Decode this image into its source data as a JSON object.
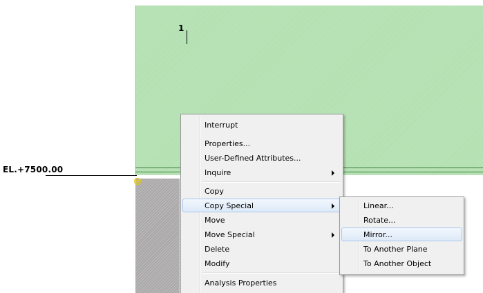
{
  "canvas": {
    "grid_label": "1",
    "elevation_label": "EL.+7500.00",
    "colors": {
      "slab_fill": "#b2e0b0",
      "column_fill": "#a9a7a7",
      "snap_marker": "#e3c820",
      "menu_background": "#f0f0f0",
      "highlight_border": "#a8c6ee"
    }
  },
  "context_menu": {
    "items": [
      {
        "label": "Interrupt"
      },
      {
        "label": "Properties..."
      },
      {
        "label": "User-Defined Attributes..."
      },
      {
        "label": "Inquire"
      },
      {
        "label": "Copy"
      },
      {
        "label": "Copy Special"
      },
      {
        "label": "Move"
      },
      {
        "label": "Move Special"
      },
      {
        "label": "Delete"
      },
      {
        "label": "Modify"
      },
      {
        "label": "Analysis Properties"
      }
    ],
    "highlighted": "Copy Special"
  },
  "submenu": {
    "items": [
      {
        "label": "Linear..."
      },
      {
        "label": "Rotate..."
      },
      {
        "label": "Mirror..."
      },
      {
        "label": "To Another Plane"
      },
      {
        "label": "To Another Object"
      }
    ],
    "highlighted": "Mirror..."
  }
}
